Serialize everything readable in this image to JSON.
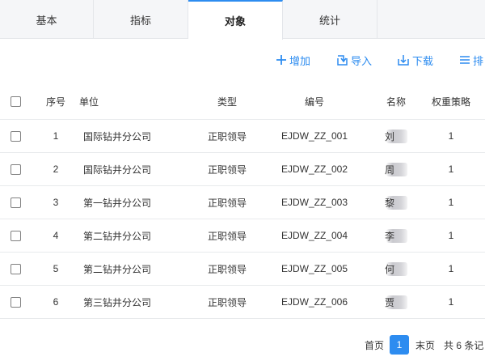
{
  "tabs": [
    {
      "label": "基本"
    },
    {
      "label": "指标"
    },
    {
      "label": "对象",
      "active": true
    },
    {
      "label": "统计"
    }
  ],
  "toolbar": {
    "add": "增加",
    "import": "导入",
    "download": "下载",
    "sort": "排"
  },
  "table": {
    "headers": {
      "index": "序号",
      "unit": "单位",
      "type": "类型",
      "code": "编号",
      "name": "名称",
      "weight": "权重策略"
    },
    "rows": [
      {
        "index": "1",
        "unit": "国际钻井分公司",
        "type": "正职领导",
        "code": "EJDW_ZZ_001",
        "name": "刘",
        "weight": "1"
      },
      {
        "index": "2",
        "unit": "国际钻井分公司",
        "type": "正职领导",
        "code": "EJDW_ZZ_002",
        "name": "周",
        "weight": "1"
      },
      {
        "index": "3",
        "unit": "第一钻井分公司",
        "type": "正职领导",
        "code": "EJDW_ZZ_003",
        "name": "黎",
        "weight": "1"
      },
      {
        "index": "4",
        "unit": "第二钻井分公司",
        "type": "正职领导",
        "code": "EJDW_ZZ_004",
        "name": "李",
        "weight": "1"
      },
      {
        "index": "5",
        "unit": "第二钻井分公司",
        "type": "正职领导",
        "code": "EJDW_ZZ_005",
        "name": "何",
        "weight": "1"
      },
      {
        "index": "6",
        "unit": "第三钻井分公司",
        "type": "正职领导",
        "code": "EJDW_ZZ_006",
        "name": "贾",
        "weight": "1"
      }
    ]
  },
  "pager": {
    "first": "首页",
    "current": "1",
    "last": "末页",
    "total": "共 6 条记"
  },
  "colors": {
    "accent": "#2d8cf0",
    "tab_bg": "#f5f6f8",
    "border": "#e8eaec"
  },
  "icons": {
    "add": "plus-icon",
    "import": "import-icon",
    "download": "download-icon",
    "sort": "list-icon"
  }
}
